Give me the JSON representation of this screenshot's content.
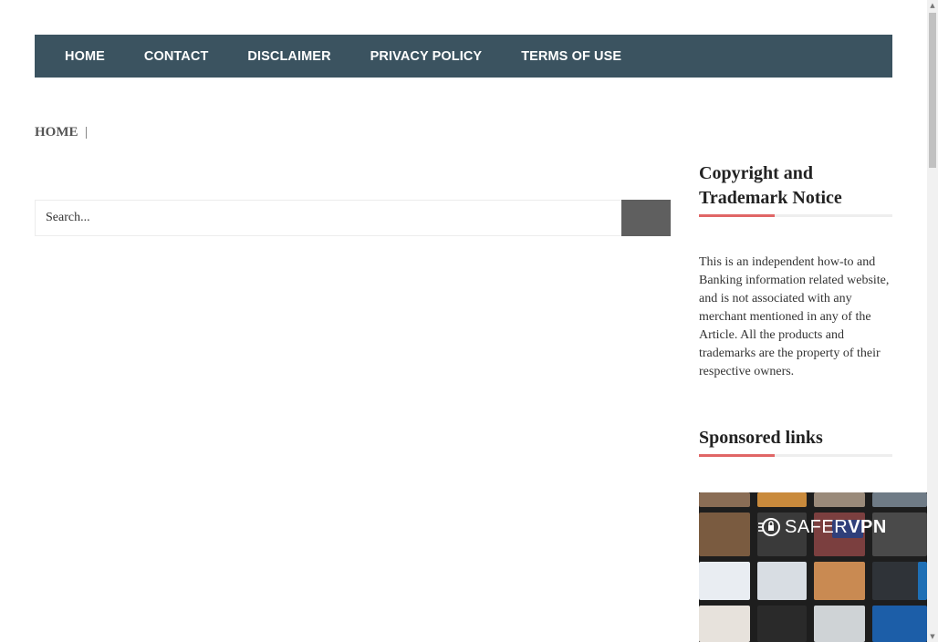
{
  "nav": {
    "items": [
      "HOME",
      "CONTACT",
      "DISCLAIMER",
      "PRIVACY POLICY",
      "TERMS OF USE"
    ]
  },
  "breadcrumb": {
    "home": "HOME"
  },
  "search": {
    "placeholder": "Search..."
  },
  "sidebar": {
    "copyright": {
      "title_line1": "Copyright and",
      "title_line2": "Trademark Notice",
      "text": "This is an independent how-to and Banking information related website, and is not associated with any merchant mentioned in any of the Article. All the products and trademarks are the property of their respective owners."
    },
    "sponsored": {
      "title": "Sponsored links"
    },
    "ad": {
      "logo_light": "SAFER",
      "logo_bold": "VPN",
      "icon": "lock-icon"
    }
  },
  "colors": {
    "nav_bg": "#3b5360",
    "accent": "#e06666",
    "search_button": "#5f5f5f"
  }
}
